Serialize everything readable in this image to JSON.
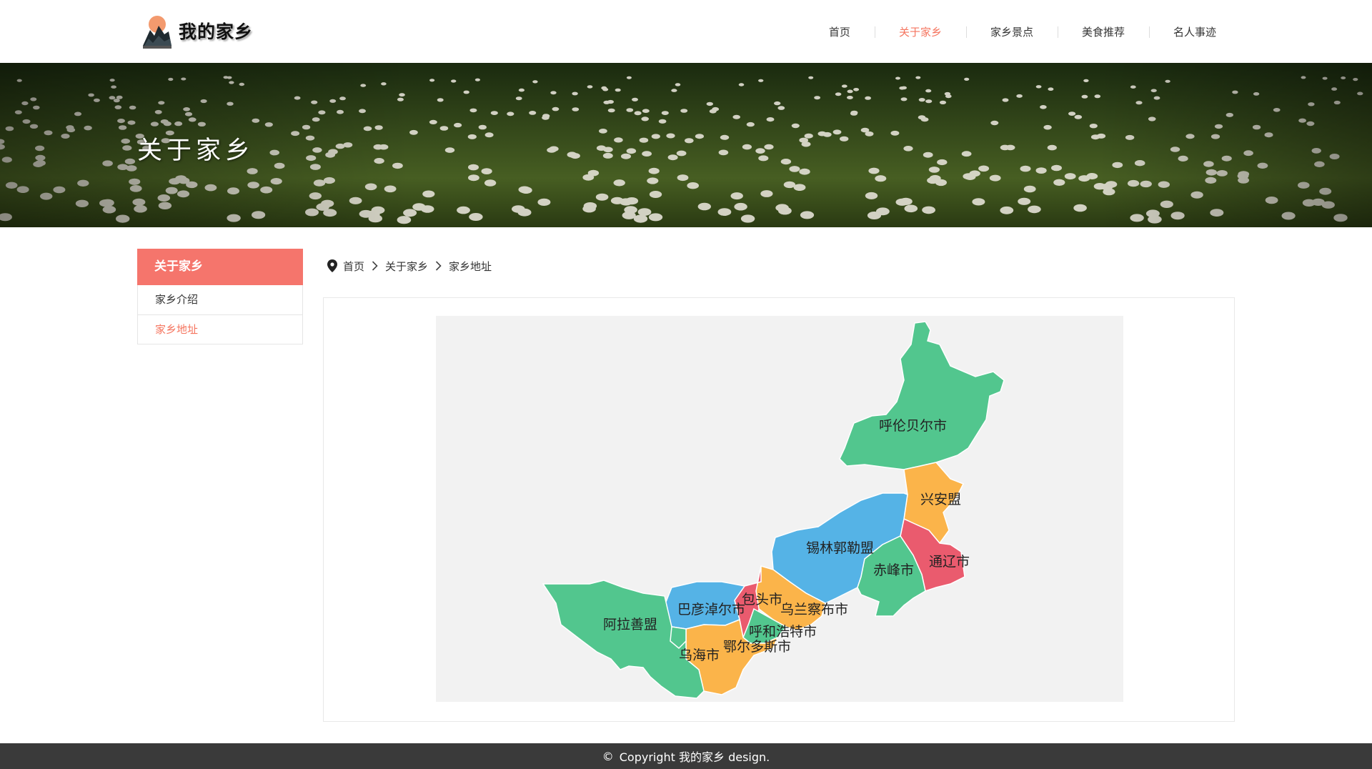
{
  "header": {
    "logo_text": "我的家乡",
    "nav": [
      {
        "label": "首页",
        "active": false
      },
      {
        "label": "关于家乡",
        "active": true
      },
      {
        "label": "家乡景点",
        "active": false
      },
      {
        "label": "美食推荐",
        "active": false
      },
      {
        "label": "名人事迹",
        "active": false
      }
    ]
  },
  "banner": {
    "title": "关于家乡"
  },
  "sidebar": {
    "title": "关于家乡",
    "items": [
      {
        "label": "家乡介绍",
        "active": false
      },
      {
        "label": "家乡地址",
        "active": true
      }
    ]
  },
  "breadcrumb": {
    "icon": "location-pin-icon",
    "items": [
      "首页",
      "关于家乡",
      "家乡地址"
    ]
  },
  "map": {
    "regions": [
      {
        "name": "呼伦贝尔市",
        "color": "#52c68e"
      },
      {
        "name": "兴安盟",
        "color": "#fbb44a"
      },
      {
        "name": "通辽市",
        "color": "#ea5b6e"
      },
      {
        "name": "锡林郭勒盟",
        "color": "#55b3e6"
      },
      {
        "name": "赤峰市",
        "color": "#52c68e"
      },
      {
        "name": "乌兰察布市",
        "color": "#fbb44a"
      },
      {
        "name": "包头市",
        "color": "#ea5b6e"
      },
      {
        "name": "巴彦淖尔市",
        "color": "#55b3e6"
      },
      {
        "name": "呼和浩特市",
        "color": "#52c68e"
      },
      {
        "name": "鄂尔多斯市",
        "color": "#fbb44a"
      },
      {
        "name": "阿拉善盟",
        "color": "#52c68e"
      },
      {
        "name": "乌海市",
        "color": "#52c68e"
      }
    ]
  },
  "footer": {
    "copyright_symbol": "©",
    "text": "Copyright 我的家乡 design."
  },
  "colors": {
    "accent": "#f5755f",
    "sidebar_head": "#f5756c",
    "footer_bg": "#3a3a3a",
    "map_bg": "#f2f2f2"
  }
}
